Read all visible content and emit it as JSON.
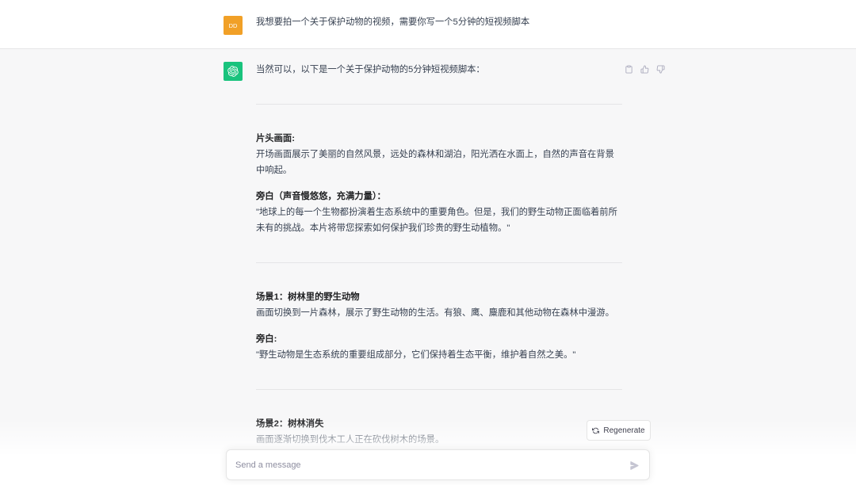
{
  "colors": {
    "user_avatar": "#f1a027",
    "assistant_avatar": "#19c37d",
    "assistant_bg": "#f7f7f8",
    "text": "#374151"
  },
  "conversation": {
    "user": {
      "avatar_initials": "DD",
      "message": "我想要拍一个关于保护动物的视频，需要你写一个5分钟的短视频脚本"
    },
    "assistant": {
      "avatar_icon": "openai-logo-icon",
      "intro": "当然可以，以下是一个关于保护动物的5分钟短视频脚本：",
      "actions": [
        "clipboard-icon",
        "thumbs-up-icon",
        "thumbs-down-icon"
      ],
      "blocks": [
        {
          "items": [
            {
              "heading": "片头画面:",
              "text": "开场画面展示了美丽的自然风景，远处的森林和湖泊，阳光洒在水面上，自然的声音在背景中响起。"
            },
            {
              "heading": "旁白（声音慢悠悠，充满力量）：",
              "text": "\"地球上的每一个生物都扮演着生态系统中的重要角色。但是，我们的野生动物正面临着前所未有的挑战。本片将带您探索如何保护我们珍贵的野生动植物。\""
            }
          ]
        },
        {
          "items": [
            {
              "heading": "场景1：树林里的野生动物",
              "text": "画面切换到一片森林，展示了野生动物的生活。有狼、鹰、麋鹿和其他动物在森林中漫游。"
            },
            {
              "heading": "旁白:",
              "text": "\"野生动物是生态系统的重要组成部分，它们保持着生态平衡，维护着自然之美。\""
            }
          ]
        },
        {
          "items": [
            {
              "heading": "场景2：树林消失",
              "text": "画面逐渐切换到伐木工人正在砍伐树木的场景。"
            }
          ]
        }
      ]
    }
  },
  "regenerate": {
    "label": "Regenerate",
    "icon": "refresh-icon"
  },
  "composer": {
    "placeholder": "Send a message",
    "send_icon": "send-icon"
  }
}
